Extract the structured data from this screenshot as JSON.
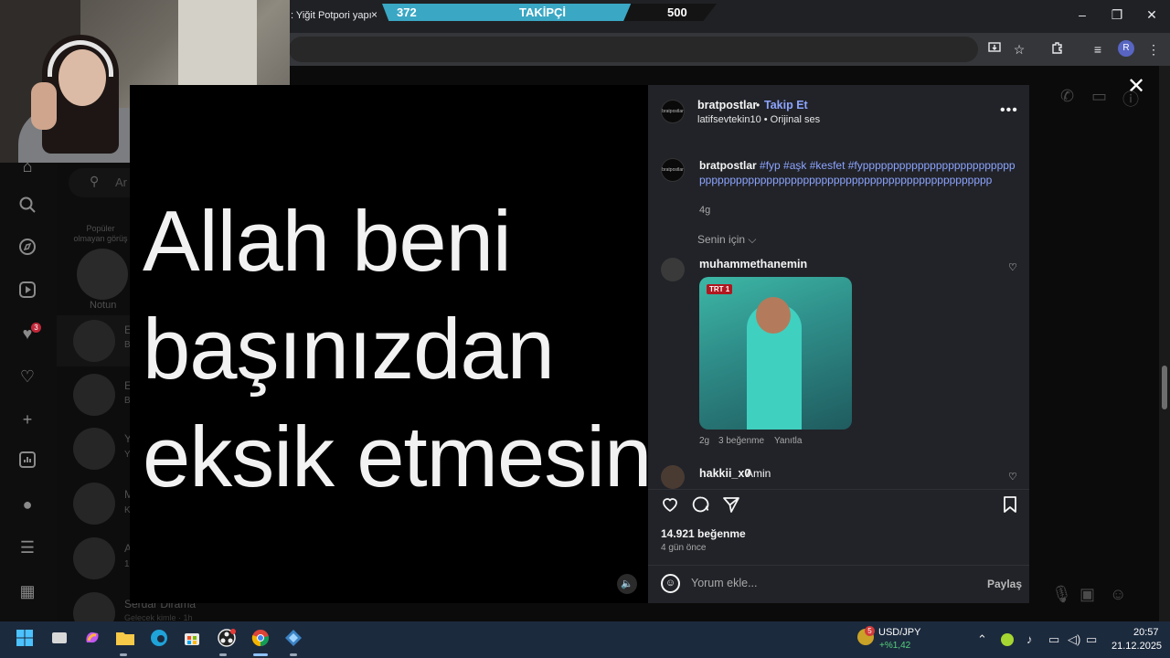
{
  "browser": {
    "tab_title": ": Yiğit Potpori yapı",
    "tab_close": "×",
    "window_controls": {
      "minimize": "–",
      "restore": "❐",
      "close": "✕"
    },
    "toolbar_icons": [
      "install-icon",
      "star-icon",
      "extensions-icon",
      "media-icon",
      "menu-icon"
    ],
    "profile_initial": "R"
  },
  "follower_goal": {
    "current": "372",
    "label": "TAKİPÇİ",
    "goal": "500",
    "progress": 0.744
  },
  "sidebar": {
    "icons": [
      "home-icon",
      "search-icon",
      "explore-icon",
      "reels-icon",
      "messages-icon",
      "notifications-icon",
      "create-icon",
      "dashboard-icon",
      "profile-icon",
      "menu-icon",
      "more-icon"
    ],
    "messages_badge": "3"
  },
  "chat_list": {
    "search_placeholder": "Ar",
    "popular_note": "Popüler olmayan görüş",
    "story_label": "Notun",
    "rows": [
      {
        "initial": "E",
        "sub": "B"
      },
      {
        "initial": "E",
        "sub": "B"
      },
      {
        "initial": "Y",
        "sub": "Y"
      },
      {
        "initial": "M",
        "sub": "K"
      },
      {
        "initial": "A",
        "sub": "1"
      }
    ],
    "bottom_name": "Serdar Dirama",
    "bottom_sub": "Gelecek kimle · 1h"
  },
  "reel": {
    "video_text": "Allah beni başınızdan eksik etmesin",
    "mute_icon": "🔈",
    "author": {
      "avatar_text": "bratpostlar",
      "username": "bratpostlar",
      "separator": "•",
      "follow_label": "Takip Et",
      "audio": "latifsevtekin10 • Orijinal ses"
    },
    "more": "•••",
    "caption": {
      "username": "bratpostlar",
      "text": "#fyp #aşk #kesfet #fyppppppppppppppppppppppppppppppppppppppppppppppppppppppppppppppppppppppppp",
      "time": "4g"
    },
    "comment_filter": "Senin için ⌵",
    "comments": [
      {
        "username": "muhammethanemin",
        "gif_badge": "TRT 1",
        "time": "2g",
        "likes": "3 beğenme",
        "reply": "Yanıtla"
      },
      {
        "username": "hakkii_x0",
        "text": "Amin"
      }
    ],
    "actions": {
      "like": "♡",
      "comment": "◯",
      "share": "➢",
      "save": "⌑"
    },
    "likes_count": "14.921 beğenme",
    "posted_ago": "4 gün önce",
    "comment_placeholder": "Yorum ekle...",
    "share_label": "Paylaş",
    "emoji_icon": "☺",
    "close_icon": "✕"
  },
  "taskbar": {
    "apps": [
      "windows-icon",
      "taskview-icon",
      "copilot-icon",
      "file-explorer-icon",
      "edge-icon",
      "store-icon",
      "obs-icon",
      "chrome-icon",
      "app-icon"
    ],
    "ticker_badge": "5",
    "ticker_name": "USD/JPY",
    "ticker_change": "+%1,42",
    "time": "20:57",
    "date": "21.12.2025"
  }
}
